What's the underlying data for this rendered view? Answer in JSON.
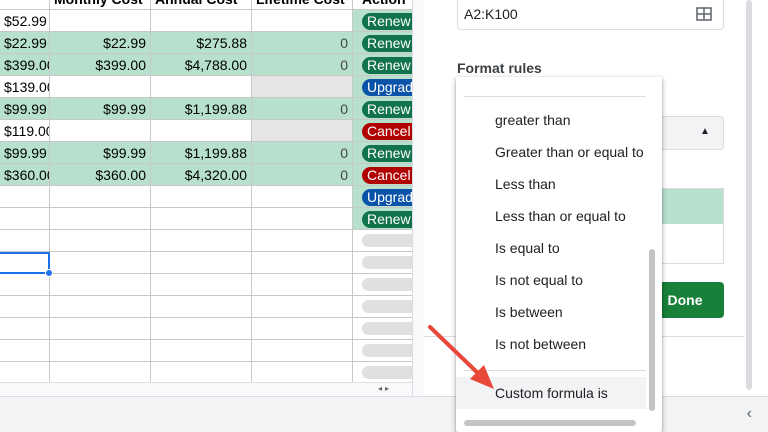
{
  "sheet": {
    "headers": [
      "",
      "Monthly Cost",
      "Annual Cost",
      "Lifetime Cost",
      "Action"
    ],
    "rows": [
      {
        "a": "$52.99",
        "b": "",
        "c": "",
        "d": "",
        "action": "Renew",
        "style": "white",
        "dstyle": "white",
        "chip": "green"
      },
      {
        "a": "$22.99",
        "b": "$22.99",
        "c": "$275.88",
        "d": "0",
        "action": "Renew",
        "style": "green",
        "dstyle": "gray",
        "chip": "green"
      },
      {
        "a": "$399.00",
        "b": "$399.00",
        "c": "$4,788.00",
        "d": "0",
        "action": "Renew",
        "style": "green",
        "dstyle": "gray",
        "chip": "green"
      },
      {
        "a": "$139.00",
        "b": "",
        "c": "",
        "d": "",
        "action": "Upgrade",
        "style": "white",
        "dstyle": "gray",
        "chip": "blue"
      },
      {
        "a": "$99.99",
        "b": "$99.99",
        "c": "$1,199.88",
        "d": "0",
        "action": "Renew",
        "style": "green",
        "dstyle": "gray",
        "chip": "green"
      },
      {
        "a": "$119.00",
        "b": "",
        "c": "",
        "d": "",
        "action": "Cancel",
        "style": "white",
        "dstyle": "gray",
        "chip": "red"
      },
      {
        "a": "$99.99",
        "b": "$99.99",
        "c": "$1,199.88",
        "d": "0",
        "action": "Renew",
        "style": "green",
        "dstyle": "gray",
        "chip": "green"
      },
      {
        "a": "$360.00",
        "b": "$360.00",
        "c": "$4,320.00",
        "d": "0",
        "action": "Cancel",
        "style": "green",
        "dstyle": "gray",
        "chip": "red"
      },
      {
        "a": "",
        "b": "",
        "c": "",
        "d": "",
        "action": "Upgrade",
        "style": "white",
        "dstyle": "white",
        "chip": "blue"
      },
      {
        "a": "",
        "b": "",
        "c": "",
        "d": "",
        "action": "Renew",
        "style": "white",
        "dstyle": "white",
        "chip": "green"
      },
      {
        "a": "",
        "b": "",
        "c": "",
        "d": "",
        "action": "",
        "style": "white",
        "dstyle": "white",
        "chip": "empty"
      },
      {
        "a": "",
        "b": "",
        "c": "",
        "d": "",
        "action": "",
        "style": "white",
        "dstyle": "white",
        "chip": "empty"
      },
      {
        "a": "",
        "b": "",
        "c": "",
        "d": "",
        "action": "",
        "style": "white",
        "dstyle": "white",
        "chip": "empty"
      },
      {
        "a": "",
        "b": "",
        "c": "",
        "d": "",
        "action": "",
        "style": "white",
        "dstyle": "white",
        "chip": "empty"
      },
      {
        "a": "",
        "b": "",
        "c": "",
        "d": "",
        "action": "",
        "style": "white",
        "dstyle": "white",
        "chip": "empty"
      },
      {
        "a": "",
        "b": "",
        "c": "",
        "d": "",
        "action": "",
        "style": "white",
        "dstyle": "white",
        "chip": "empty"
      },
      {
        "a": "",
        "b": "",
        "c": "",
        "d": "",
        "action": "",
        "style": "white",
        "dstyle": "white",
        "chip": "empty"
      }
    ]
  },
  "panel": {
    "range_value": "A2:K100",
    "format_rules_label": "Format rules",
    "done_label": "Done"
  },
  "dropdown": {
    "items": [
      "greater than",
      "Greater than or equal to",
      "Less than",
      "Less than or equal to",
      "Is equal to",
      "Is not equal to",
      "Is between",
      "Is not between"
    ],
    "highlighted_item": "Custom formula is"
  },
  "colors": {
    "green_fill": "#b7e1cd",
    "done_button": "#188038",
    "arrow": "#e8483a",
    "selection": "#1a73e8"
  },
  "icons": {
    "range_icon": "grid-select-icon",
    "select_caret": "caret-up-icon",
    "bottom_chevron": "chevron-left-icon"
  }
}
